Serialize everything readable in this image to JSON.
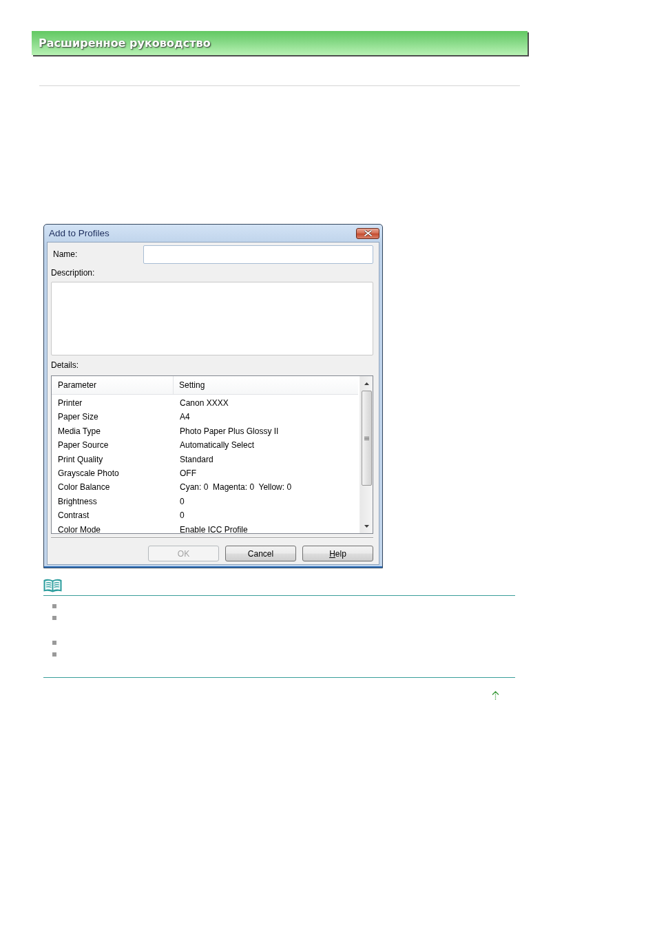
{
  "header": {
    "title": "Расширенное руководство"
  },
  "dialog": {
    "title": "Add to Profiles",
    "name_field": {
      "label": "Name:"
    },
    "description_field": {
      "label": "Description:"
    },
    "details": {
      "label": "Details:",
      "columns": [
        "Parameter",
        "Setting"
      ],
      "rows": [
        {
          "parameter": "Printer",
          "setting": "Canon XXXX"
        },
        {
          "parameter": "Paper Size",
          "setting": "A4"
        },
        {
          "parameter": "Media Type",
          "setting": "Photo Paper Plus Glossy II"
        },
        {
          "parameter": "Paper Source",
          "setting": "Automatically Select"
        },
        {
          "parameter": "Print Quality",
          "setting": "Standard"
        },
        {
          "parameter": "Grayscale Photo",
          "setting": "OFF"
        },
        {
          "parameter": "Color Balance",
          "setting": "Cyan: 0  Magenta: 0  Yellow: 0"
        },
        {
          "parameter": "Brightness",
          "setting": "0"
        },
        {
          "parameter": "Contrast",
          "setting": "0"
        },
        {
          "parameter": "Color Mode",
          "setting": "Enable ICC Profile"
        }
      ]
    },
    "buttons": [
      {
        "label": "OK",
        "disabled": true,
        "mnemonic": false
      },
      {
        "label": "Cancel",
        "disabled": false,
        "mnemonic": false
      },
      {
        "label": "Help",
        "disabled": false,
        "mnemonic": true
      }
    ]
  },
  "note": {
    "items": [
      {
        "kind": "bullet"
      },
      {
        "kind": "bullet"
      },
      {
        "kind": "bullet"
      },
      {
        "kind": "bullet"
      }
    ]
  }
}
